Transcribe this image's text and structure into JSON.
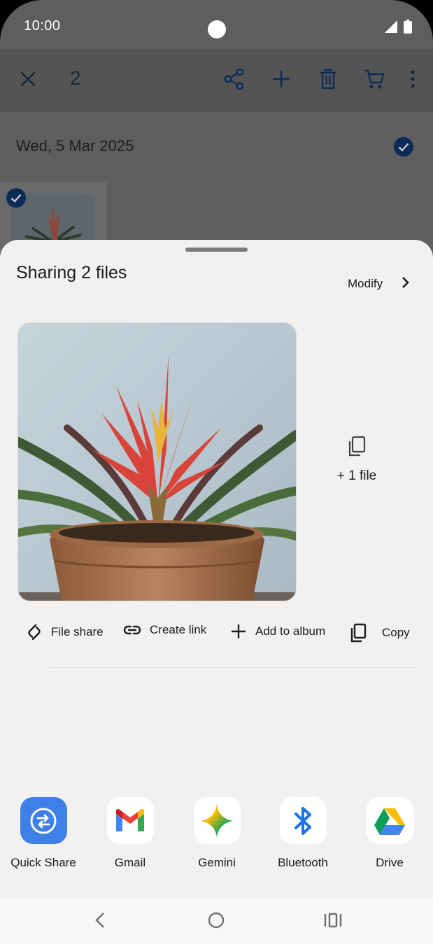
{
  "status_bar": {
    "time": "10:00"
  },
  "toolbar": {
    "selected_count": "2"
  },
  "gallery": {
    "date_header": "Wed, 5 Mar 2025"
  },
  "share_sheet": {
    "title": "Sharing 2 files",
    "modify_label": "Modify",
    "additional_files": "+ 1 file",
    "actions": [
      {
        "label": "File share",
        "icon": "file-share-icon"
      },
      {
        "label": "Create link",
        "icon": "link-icon"
      },
      {
        "label": "Add to album",
        "icon": "plus-icon"
      },
      {
        "label": "Copy",
        "icon": "copy-icon"
      }
    ],
    "apps": [
      {
        "label": "Quick Share",
        "icon": "quick-share-icon"
      },
      {
        "label": "Gmail",
        "icon": "gmail-icon"
      },
      {
        "label": "Gemini",
        "icon": "gemini-icon"
      },
      {
        "label": "Bluetooth",
        "icon": "bluetooth-icon"
      },
      {
        "label": "Drive",
        "icon": "drive-icon"
      }
    ]
  },
  "colors": {
    "accent": "#0b57d0",
    "sheet_background": "#f3f1f0",
    "scrim": "#5e5e5e",
    "quick_share_blue": "#3f7fe8"
  }
}
